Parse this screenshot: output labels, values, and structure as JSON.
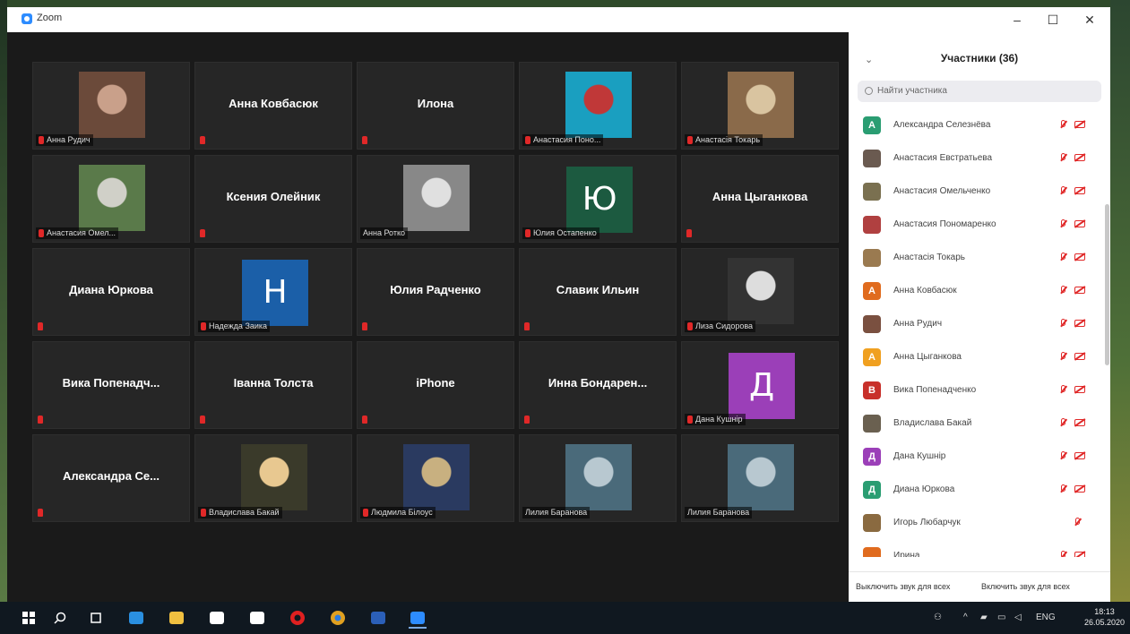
{
  "window": {
    "title": "Zoom",
    "controls": [
      "–",
      "☐",
      "✕"
    ]
  },
  "tiles": [
    {
      "type": "photo",
      "label": "Анна Рудич",
      "mic": true,
      "colors": [
        "#6b4a3a",
        "#c9a08a"
      ]
    },
    {
      "type": "name",
      "name": "Анна Ковбасюк",
      "mic": true
    },
    {
      "type": "name",
      "name": "Илона",
      "mic": true
    },
    {
      "type": "photo",
      "label": "Анастасия Поно...",
      "mic": true,
      "colors": [
        "#1a9fc0",
        "#c03838"
      ]
    },
    {
      "type": "photo",
      "label": "Анастасія Токарь",
      "mic": true,
      "colors": [
        "#8a6a4a",
        "#d9c4a0"
      ]
    },
    {
      "type": "photo",
      "label": "Анастасия Омел...",
      "mic": true,
      "colors": [
        "#5a7a4a",
        "#d0d0c8"
      ]
    },
    {
      "type": "name",
      "name": "Ксения Олейник",
      "mic": true
    },
    {
      "type": "photo",
      "label": "Анна Ротко",
      "mic": false,
      "colors": [
        "#888",
        "#e0e0e0"
      ]
    },
    {
      "type": "letter",
      "letter": "Ю",
      "bg": "#1c5a40",
      "label": "Юлия Остапенко",
      "mic": true
    },
    {
      "type": "name",
      "name": "Анна Цыганкова",
      "mic": true
    },
    {
      "type": "name",
      "name": "Диана Юркова",
      "mic": true
    },
    {
      "type": "letter",
      "letter": "Н",
      "bg": "#1b5fa8",
      "label": "Надежда Заика",
      "mic": true
    },
    {
      "type": "name",
      "name": "Юлия Радченко",
      "mic": true
    },
    {
      "type": "name",
      "name": "Славик Ильин",
      "mic": true
    },
    {
      "type": "photo",
      "label": "Лиза Сидорова",
      "mic": true,
      "colors": [
        "#333",
        "#ddd"
      ]
    },
    {
      "type": "name",
      "name": "Вика Попенадч...",
      "mic": true
    },
    {
      "type": "name",
      "name": "Іванна Толста",
      "mic": true
    },
    {
      "type": "name",
      "name": "iPhone",
      "mic": true
    },
    {
      "type": "name",
      "name": "Инна Бондарен...",
      "mic": true
    },
    {
      "type": "letter",
      "letter": "Д",
      "bg": "#9b3fb8",
      "label": "Дана Кушнір",
      "mic": true
    },
    {
      "type": "name",
      "name": "Александра Се...",
      "mic": true
    },
    {
      "type": "photo",
      "label": "Владислава Бакай",
      "mic": true,
      "colors": [
        "#3a3a2a",
        "#e8c890"
      ]
    },
    {
      "type": "photo",
      "label": "Людмила Білоус",
      "mic": true,
      "colors": [
        "#2a3a60",
        "#c8b080"
      ]
    },
    {
      "type": "photo",
      "label": "Лилия Баранова",
      "mic": false,
      "colors": [
        "#4a6a7a",
        "#b8c8d0"
      ]
    },
    {
      "type": "photo",
      "label": "Лилия Баранова",
      "mic": false,
      "colors": [
        "#4a6a7a",
        "#b8c8d0"
      ]
    }
  ],
  "panel": {
    "title": "Участники (36)",
    "collapse": "⌄",
    "search_placeholder": "Найти участника",
    "participants": [
      {
        "name": "Александра Селезнёва",
        "initial": "А",
        "bg": "#2a9d72",
        "mic": true,
        "cam": true
      },
      {
        "name": "Анастасия Евстратьева",
        "initial": "",
        "bg": "#6a5a50",
        "mic": true,
        "cam": true
      },
      {
        "name": "Анастасия Омельченко",
        "initial": "",
        "bg": "#7a7050",
        "mic": true,
        "cam": true
      },
      {
        "name": "Анастасия Пономаренко",
        "initial": "",
        "bg": "#b04040",
        "mic": true,
        "cam": true
      },
      {
        "name": "Анастасія Токарь",
        "initial": "",
        "bg": "#9a7a50",
        "mic": true,
        "cam": true
      },
      {
        "name": "Анна Ковбасюк",
        "initial": "А",
        "bg": "#e06b1e",
        "mic": true,
        "cam": true
      },
      {
        "name": "Анна Рудич",
        "initial": "",
        "bg": "#7a5040",
        "mic": true,
        "cam": true
      },
      {
        "name": "Анна Цыганкова",
        "initial": "А",
        "bg": "#f0a020",
        "mic": true,
        "cam": true
      },
      {
        "name": "Вика Попенадченко",
        "initial": "В",
        "bg": "#c8302a",
        "mic": true,
        "cam": true
      },
      {
        "name": "Владислава Бакай",
        "initial": "",
        "bg": "#6a6050",
        "mic": true,
        "cam": true
      },
      {
        "name": "Дана Кушнір",
        "initial": "Д",
        "bg": "#9b3fb8",
        "mic": true,
        "cam": true
      },
      {
        "name": "Диана Юркова",
        "initial": "Д",
        "bg": "#2a9d72",
        "mic": true,
        "cam": true
      },
      {
        "name": "Игорь Любарчук",
        "initial": "",
        "bg": "#8a6a40",
        "mic": true,
        "cam": false
      },
      {
        "name": "Ирина",
        "initial": "",
        "bg": "#e06b1e",
        "mic": true,
        "cam": true
      }
    ],
    "footer": {
      "mute_all": "Выключить звук для всех",
      "unmute_all": "Включить звук для всех"
    }
  },
  "taskbar": {
    "lang": "ENG",
    "time": "18:13",
    "date": "26.05.2020",
    "apps": [
      {
        "name": "windows-icon",
        "color": "#fff"
      },
      {
        "name": "search-icon",
        "color": "#fff"
      },
      {
        "name": "task-view-icon",
        "color": "#fff"
      },
      {
        "name": "edge-icon",
        "color": "#2a8fe0"
      },
      {
        "name": "explorer-icon",
        "color": "#f0c040"
      },
      {
        "name": "store-icon",
        "color": "#fff"
      },
      {
        "name": "file-icon",
        "color": "#fff"
      },
      {
        "name": "opera-icon",
        "color": "#e02020"
      },
      {
        "name": "chrome-icon",
        "color": "#e0a020"
      },
      {
        "name": "word-icon",
        "color": "#2b5fb8"
      },
      {
        "name": "zoom-icon",
        "color": "#2d8cff"
      }
    ]
  }
}
